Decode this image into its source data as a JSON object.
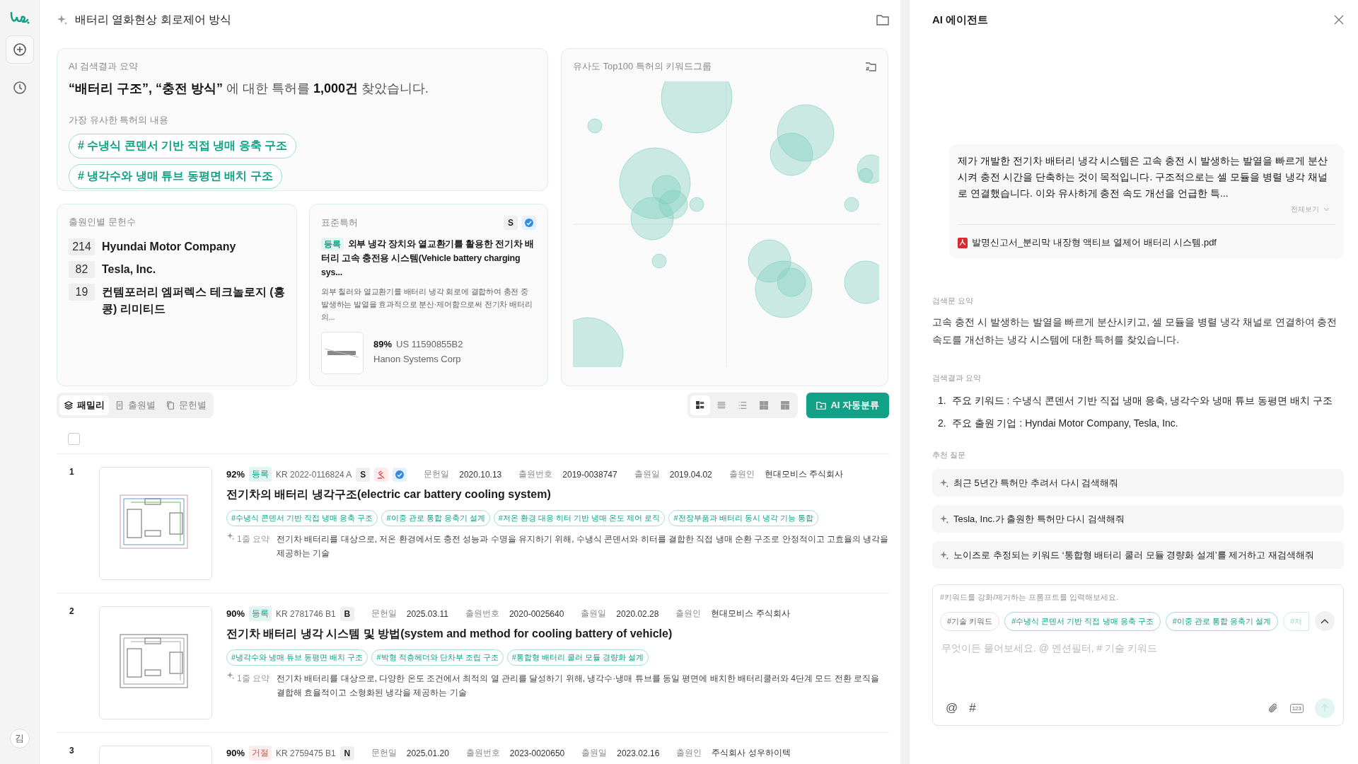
{
  "sidebar": {
    "user_initial": "김"
  },
  "header": {
    "title": "배터리 열화현상 회로제어 방식"
  },
  "summary": {
    "label": "AI 검색결과 요약",
    "headline": "**“배터리 구조”, “충전 방식”** 에 대한 특허를 **1,000건** 찾았습니다.",
    "similar_label": "가장 유사한 특허의 내용",
    "keyword_tags": [
      "# 수냉식 콘덴서 기반 직접 냉매 응축 구조",
      "# 냉각수와 냉매 튜브 동평면 배치 구조"
    ]
  },
  "keyword_chart": {
    "title": "유사도 Top100 특허의 키워드그룹"
  },
  "applicants": {
    "title": "출원인별 문헌수",
    "rows": [
      {
        "count": "214",
        "name": "Hyundai Motor Company"
      },
      {
        "count": "82",
        "name": "Tesla, Inc."
      },
      {
        "count": "19",
        "name": "컨템포러리 엠퍼렉스 테크놀로지 (홍콩) 리미티드"
      }
    ]
  },
  "standard_patent": {
    "title": "표준특허",
    "badges": [
      {
        "kind": "letter",
        "label": "S"
      },
      {
        "kind": "standard"
      }
    ],
    "status": "등록",
    "patent_title": "외부 냉각 장치와 열교환기를 활용한 전기차 배터리 고속 충전용 시스템(Vehicle battery charging sys...",
    "summary": "외부 칠러와 열교환기를 배터리 냉각 회로에 결합하여 충전 중 발생하는 발열을 효과적으로 분산·제어함으로써 전기차 배터리의...",
    "similarity": "89%",
    "number": "US 11590855B2",
    "company": "Hanon Systems Corp"
  },
  "list_toolbar": {
    "view_tabs": [
      {
        "kind": "layers",
        "label": "패밀리",
        "selected": true
      },
      {
        "kind": "doc",
        "label": "출원별",
        "selected": false
      },
      {
        "kind": "copy",
        "label": "문헌별",
        "selected": false
      }
    ],
    "view_modes": [
      {
        "kind": "detail",
        "selected": true
      },
      {
        "kind": "compact",
        "selected": false
      },
      {
        "kind": "list",
        "selected": false
      },
      {
        "kind": "grid",
        "selected": false
      },
      {
        "kind": "table",
        "selected": false
      }
    ],
    "classify_button": "AI 자동분류",
    "select_all": false
  },
  "patents": [
    {
      "index": "1",
      "similarity": "92%",
      "status": {
        "kind": "granted",
        "label": "등록"
      },
      "number": "KR 2022-0116824 A",
      "badges": [
        {
          "kind": "letter",
          "label": "S"
        },
        {
          "kind": "litigation"
        },
        {
          "kind": "standard"
        }
      ],
      "meta": [
        {
          "label": "문헌일",
          "value": "2020.10.13"
        },
        {
          "label": "출원번호",
          "value": "2019-0038747"
        },
        {
          "label": "출원일",
          "value": "2019.04.02"
        },
        {
          "label": "출원인",
          "value": "현대모비스 주식회사"
        }
      ],
      "title": "전기차의 배터리 냉각구조(electric car battery cooling system)",
      "tags": [
        "#수냉식 콘덴서  기반 직접 냉매 응축 구조",
        "#이중 관로 통합 응축기 설계",
        "#저온 환경 대응 히터 기반 냉매 온도 제어 로직",
        "#전장부품과 배터리 동시 냉각 기능 통합"
      ],
      "summary_label": "1줄 요약",
      "summary": "전기차 배터리를 대상으로, 저온 환경에서도 충전 성능과 수명을 유지하기 위해, 수냉식 콘덴서와 히터를 결합한 직접 냉매 순환 구조로 안정적이고 고효율의 냉각을 제공하는 기술"
    },
    {
      "index": "2",
      "similarity": "90%",
      "status": {
        "kind": "granted",
        "label": "등록"
      },
      "number": "KR 2781746 B1",
      "badges": [
        {
          "kind": "letter",
          "label": "B"
        }
      ],
      "meta": [
        {
          "label": "문헌일",
          "value": "2025.03.11"
        },
        {
          "label": "출원번호",
          "value": "2020-0025640"
        },
        {
          "label": "출원일",
          "value": "2020.02.28"
        },
        {
          "label": "출원인",
          "value": "현대모비스 주식회사"
        }
      ],
      "title": "전기차 배터리 냉각 시스템 및 방법(system and method for cooling battery of vehicle)",
      "tags": [
        "#냉각수와 냉매 튜브 동평면 배치 구조",
        "#박형 적층헤더와 단차부 조립 구조",
        "#통합형 배터리 쿨러 모듈 경량화 설계"
      ],
      "summary_label": "1줄 요약",
      "summary": "전기차 배터리를 대상으로, 다양한 온도 조건에서 최적의 열 관리를 달성하기 위해, 냉각수·냉매 튜브를 동일 평면에 배치한 배터리쿨러와 4단계 모드 전환 로직을 결합해 효율적이고 소형화된 냉각을 제공하는 기술"
    },
    {
      "index": "3",
      "similarity": "90%",
      "status": {
        "kind": "rejected",
        "label": "거절"
      },
      "number": "KR 2759475 B1",
      "badges": [
        {
          "kind": "letter",
          "label": "N"
        }
      ],
      "meta": [
        {
          "label": "문헌일",
          "value": "2025.01.20"
        },
        {
          "label": "출원번호",
          "value": "2023-0020650"
        },
        {
          "label": "출원일",
          "value": "2023.02.16"
        },
        {
          "label": "출원인",
          "value": "주식회사 성우하이텍"
        }
      ]
    }
  ],
  "agent": {
    "title": "AI 에이전트",
    "message": {
      "text": "제가 개발한 전기차 배터리 냉각 시스템은 고속 충전 시 발생하는 발열을 빠르게 분산시켜 충전 시간을 단축하는 것이 목적입니다. 구조적으로는 셀 모듈을 병렬 냉각 채널로 연결했습니다. 이와 유사하게 충전 속도 개선을 언급한 특...",
      "expand": "전체보기",
      "attachment": "발명신고서_분리막 내장형 액티브 열제어 배터리 시스템.pdf"
    },
    "query_summary": {
      "label": "검색문 요약",
      "text": "고속 충전 시 발생하는 발열을 빠르게 분산시키고, 셀 모듈을 병렬 냉각 채널로 연결하여 충전 속도를 개선하는 냉각 시스템에 대한 특허를 찾있습니다."
    },
    "results_summary": {
      "label": "검색결과 요약",
      "items": [
        {
          "marker": "1.",
          "text": "주요 키워드 : 수냉식 콘덴서 기반 직접 냉매 응축, 냉각수와 냉매 튜브 동평면 배치 구조"
        },
        {
          "marker": "2.",
          "text": "주요 출원 기업 : Hyndai Motor Company, Tesla, Inc."
        }
      ]
    },
    "suggestions": {
      "label": "추천 질문",
      "items": [
        "최근 5년간 특허만 추려서 다시 검색해줘",
        "Tesla, Inc.가 출원한 특허만 다시 검색해줘",
        "노이즈로 추정되는 키워드 ‘통합형 배터리 쿨러 모듈 경량화 설계’를 제거하고 재검색해줘"
      ]
    },
    "composer": {
      "hint": "#키워드를 강화/제거하는 프롬프트를 입력해보세요.",
      "chips": [
        {
          "kind": "neutral",
          "label": "#기술 키워드"
        },
        {
          "kind": "keyword",
          "label": "#수냉식 콘덴서  기반 직접 냉매 응축 구조"
        },
        {
          "kind": "keyword",
          "label": "#이중 관로 통합 응축기 설계"
        },
        {
          "kind": "keyword",
          "label": "#저"
        }
      ],
      "placeholder": "무엇이든 물어보세요. @ 멘션필터, # 기술 키워드",
      "mention_key": "@",
      "hashtag_key": "#",
      "number_key": "123",
      "send_enabled": false
    }
  }
}
